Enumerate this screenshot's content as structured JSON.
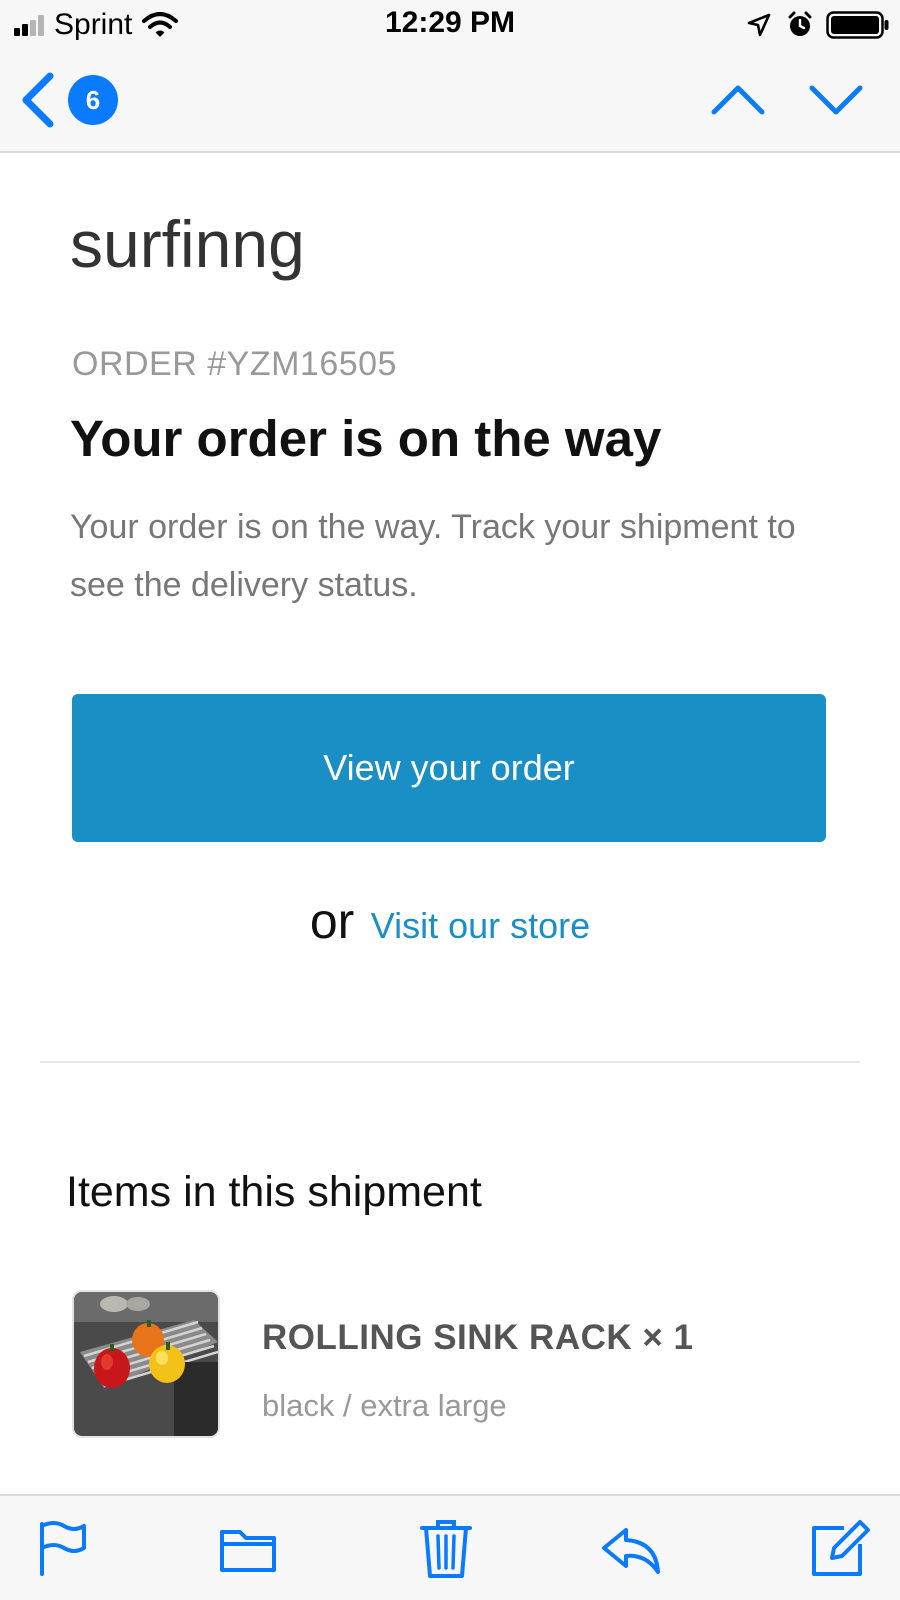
{
  "status_bar": {
    "carrier": "Sprint",
    "time": "12:29 PM",
    "icons": [
      "signal-bars-icon",
      "wifi-icon",
      "location-arrow-icon",
      "alarm-icon",
      "battery-icon"
    ]
  },
  "nav": {
    "back_icon": "chevron-left-icon",
    "unread_count": "6",
    "prev_icon": "chevron-up-icon",
    "next_icon": "chevron-down-icon"
  },
  "email": {
    "shop_name": "surfinng",
    "order_number": "ORDER #YZM16505",
    "headline": "Your order is on the way",
    "description": "Your order is on the way. Track your shipment to see the delivery status.",
    "view_order_button": "View your order",
    "or_text": "or",
    "store_link": "Visit our store",
    "shipment_title": "Items in this shipment",
    "items": [
      {
        "name": "ROLLING SINK RACK × 1",
        "variant": "black / extra large"
      }
    ]
  },
  "toolbar": {
    "icons": [
      "flag-icon",
      "folder-icon",
      "trash-icon",
      "reply-icon",
      "compose-icon"
    ]
  },
  "colors": {
    "ios_blue": "#0a7aff",
    "button_blue": "#1a8fc6",
    "bar_background": "#f7f7f7"
  }
}
